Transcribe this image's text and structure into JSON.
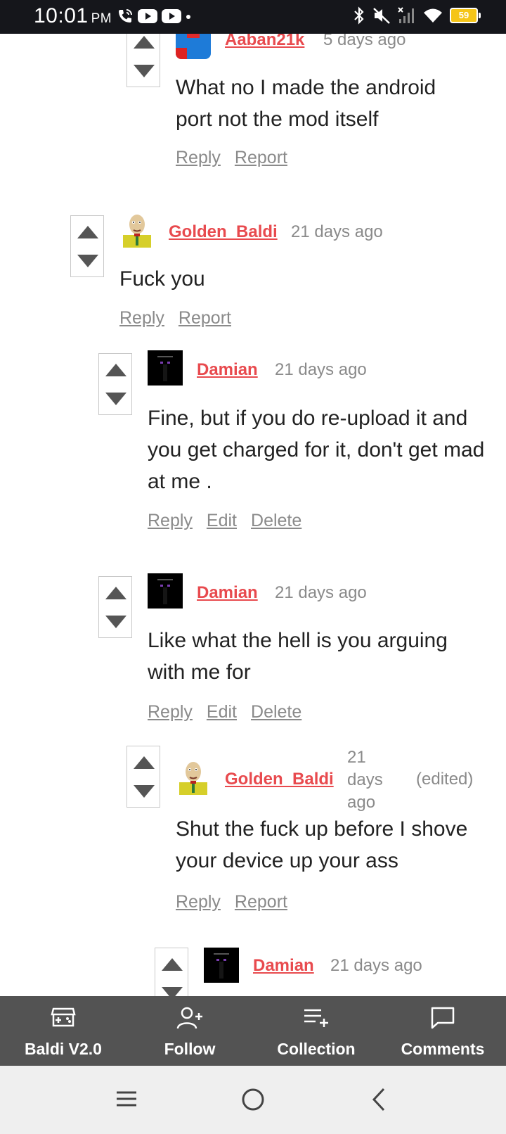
{
  "status": {
    "time": "10:01",
    "ampm": "PM",
    "battery": "59"
  },
  "comments": [
    {
      "user": "Aaban21k",
      "time": "5 days ago",
      "edited": "",
      "body": "What no I made the android port not the mod itself",
      "actions": [
        "Reply",
        "Report"
      ]
    },
    {
      "user": "Golden_Baldi",
      "time": "21 days ago",
      "edited": "",
      "body": "Fuck you",
      "actions": [
        "Reply",
        "Report"
      ]
    },
    {
      "user": "Damian",
      "time": "21 days ago",
      "edited": "",
      "body": "Fine, but if you do re-upload it and you get charged for it, don't get mad at me .",
      "actions": [
        "Reply",
        "Edit",
        "Delete"
      ]
    },
    {
      "user": "Damian",
      "time": "21 days ago",
      "edited": "",
      "body": "Like what the hell is you arguing with me for",
      "actions": [
        "Reply",
        "Edit",
        "Delete"
      ]
    },
    {
      "user": "Golden_Baldi",
      "time": "21 days ago",
      "edited": "(edited)",
      "body": "Shut the fuck up before I shove your device up your ass",
      "actions": [
        "Reply",
        "Report"
      ]
    },
    {
      "user": "Damian",
      "time": "21 days ago",
      "edited": "",
      "body": "",
      "actions": []
    }
  ],
  "action_bar": [
    {
      "label": "Baldi V2.0",
      "icon": "game-controller-icon"
    },
    {
      "label": "Follow",
      "icon": "add-person-icon"
    },
    {
      "label": "Collection",
      "icon": "add-to-list-icon"
    },
    {
      "label": "Comments",
      "icon": "comment-bubble-icon"
    }
  ],
  "colors": {
    "username": "#e84a4e",
    "meta": "#8a8a8a",
    "action_bar": "#535353"
  }
}
